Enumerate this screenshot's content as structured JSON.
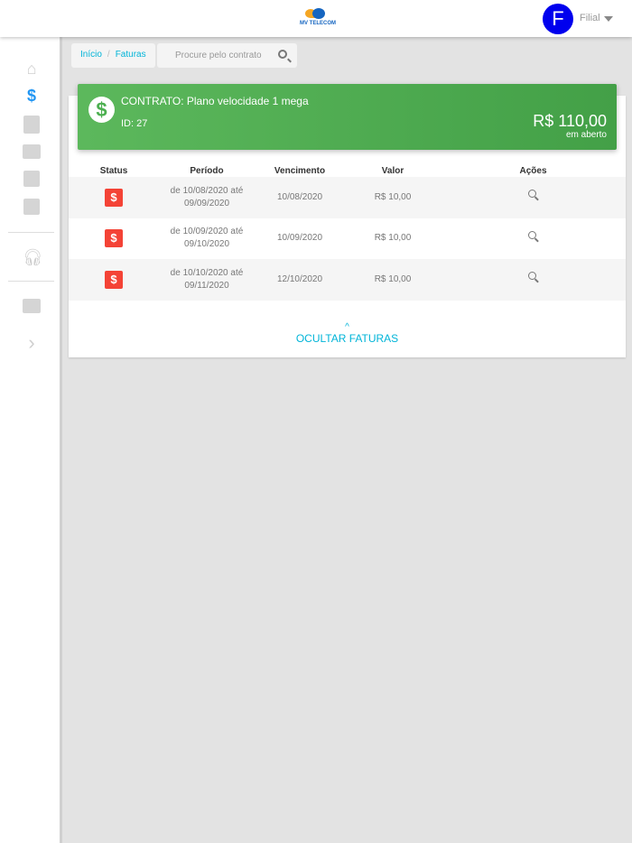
{
  "header": {
    "logo_text": "MV TELECOM",
    "avatar_letter": "F",
    "user_label": "Filial"
  },
  "sidebar": {
    "items": [
      {
        "icon": "home-icon"
      },
      {
        "icon": "dollar-icon",
        "glyph": "$",
        "active": true
      },
      {
        "icon": "receipt-icon"
      },
      {
        "icon": "document-icon"
      },
      {
        "icon": "chart-icon"
      },
      {
        "icon": "library-icon"
      },
      {
        "icon": "headset-icon"
      },
      {
        "icon": "chat-icon"
      },
      {
        "icon": "chevron-right-icon",
        "glyph": "›"
      }
    ]
  },
  "breadcrumb": {
    "home": "Início",
    "sep": "/",
    "current": "Faturas"
  },
  "search": {
    "placeholder": "Procure pelo contrato"
  },
  "contract": {
    "title": "CONTRATO: Plano velocidade 1 mega",
    "id": "ID: 27",
    "amount": "R$ 110,00",
    "amount_label": "em aberto",
    "coin": "$"
  },
  "table": {
    "headers": [
      "Status",
      "Período",
      "Vencimento",
      "Valor",
      "Ações"
    ],
    "rows": [
      {
        "status": "$",
        "period": "de 10/08/2020 até 09/09/2020",
        "due": "10/08/2020",
        "value": "R$ 10,00"
      },
      {
        "status": "$",
        "period": "de 10/09/2020 até 09/10/2020",
        "due": "10/09/2020",
        "value": "R$ 10,00"
      },
      {
        "status": "$",
        "period": "de 10/10/2020 até 09/11/2020",
        "due": "12/10/2020",
        "value": "R$ 10,00"
      }
    ]
  },
  "hide_button": {
    "chevron": "^",
    "label": "OCULTAR FATURAS"
  },
  "colors": {
    "accent": "#00b4d8",
    "green": "#4caf50",
    "status_red": "#f44336",
    "avatar": "#0000ee"
  }
}
